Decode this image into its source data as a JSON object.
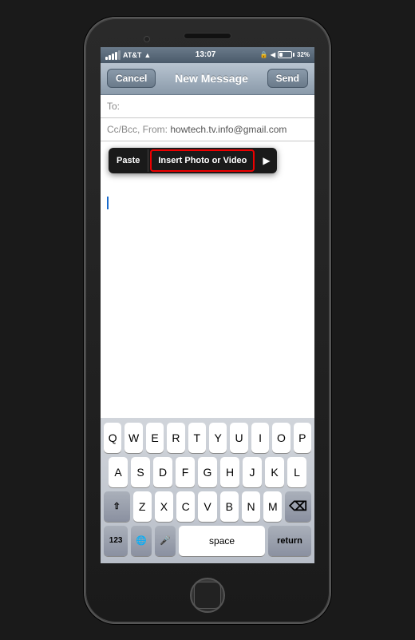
{
  "phone": {
    "status_bar": {
      "carrier": "AT&T",
      "wifi_icon": "wifi",
      "time": "13:07",
      "lock_icon": "lock",
      "location_icon": "location",
      "battery_pct": "32%"
    },
    "nav_bar": {
      "cancel_label": "Cancel",
      "title": "New Message",
      "send_label": "Send"
    },
    "to_field": {
      "label": "To:"
    },
    "cc_field": {
      "label": "Cc/Bcc, From:",
      "value": "howtech.tv.info@gmail.com"
    },
    "context_menu": {
      "paste_label": "Paste",
      "insert_label": "Insert Photo or Video",
      "arrow_label": "▶"
    },
    "keyboard": {
      "row1": [
        "Q",
        "W",
        "E",
        "R",
        "T",
        "Y",
        "U",
        "I",
        "O",
        "P"
      ],
      "row2": [
        "A",
        "S",
        "D",
        "F",
        "G",
        "H",
        "J",
        "K",
        "L"
      ],
      "row3": [
        "Z",
        "X",
        "C",
        "V",
        "B",
        "N",
        "M"
      ],
      "shift_label": "⇧",
      "delete_label": "⌫",
      "num_label": "123",
      "globe_label": "🌐",
      "mic_label": "🎤",
      "space_label": "space",
      "return_label": "return"
    }
  }
}
